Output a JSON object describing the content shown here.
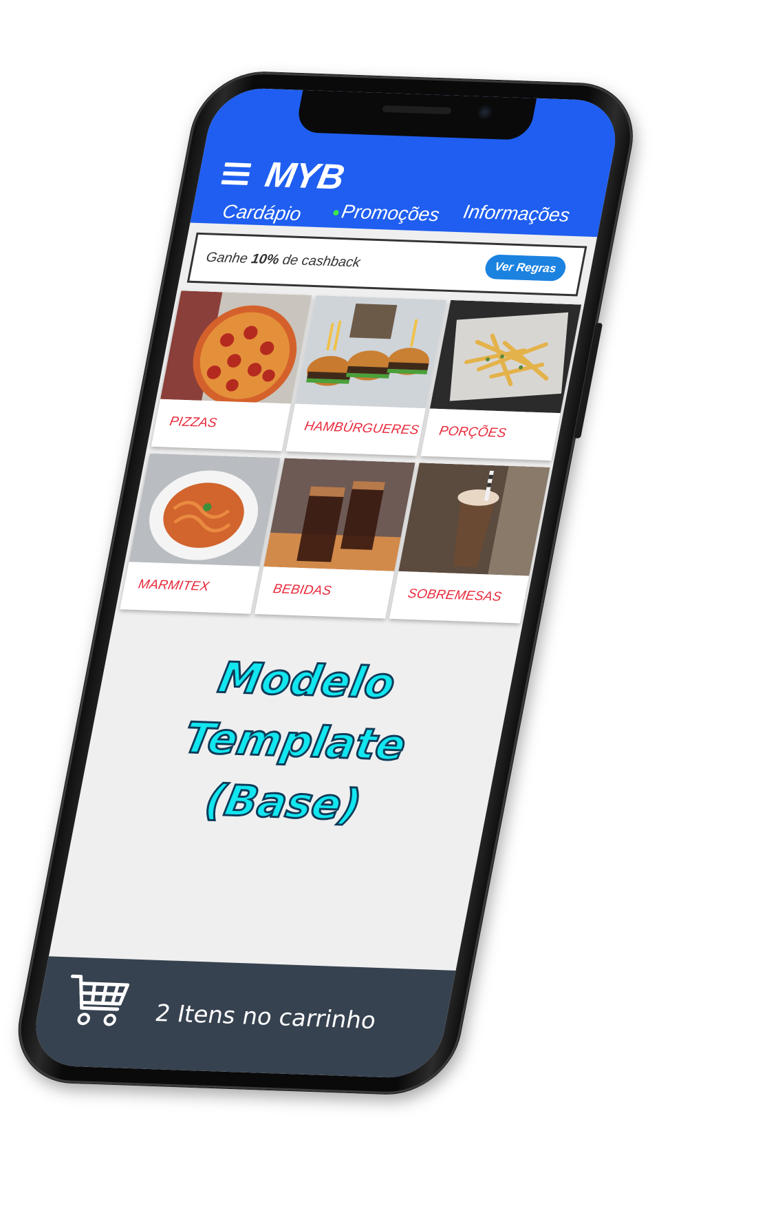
{
  "header": {
    "brand": "MYB",
    "menu_icon": "hamburger-menu-icon",
    "tabs": [
      {
        "label": "Cardápio",
        "active": true
      },
      {
        "label": "Promoções",
        "has_dot": true
      },
      {
        "label": "Informações"
      }
    ]
  },
  "cashback": {
    "prefix": "Ganhe ",
    "percent": "10%",
    "suffix": " de cashback",
    "button_label": "Ver Regras"
  },
  "categories": [
    {
      "label": "PIZZAS",
      "image": "pizza-photo"
    },
    {
      "label": "HAMBÚRGUERES",
      "image": "burgers-photo"
    },
    {
      "label": "PORÇÕES",
      "image": "fries-photo"
    },
    {
      "label": "MARMITEX",
      "image": "pasta-photo"
    },
    {
      "label": "BEBIDAS",
      "image": "soda-photo"
    },
    {
      "label": "SOBREMESAS",
      "image": "milkshake-photo"
    }
  ],
  "overlay": {
    "line1": "Modelo Template",
    "line2": "(Base)"
  },
  "cart": {
    "icon": "shopping-cart-icon",
    "text": "2 Itens no carrinho"
  },
  "colors": {
    "header": "#1f5ef0",
    "category_label": "#e8293a",
    "rules_button": "#1b82e0",
    "cart_bar": "#374250",
    "overlay_text": "#12e6ef"
  }
}
